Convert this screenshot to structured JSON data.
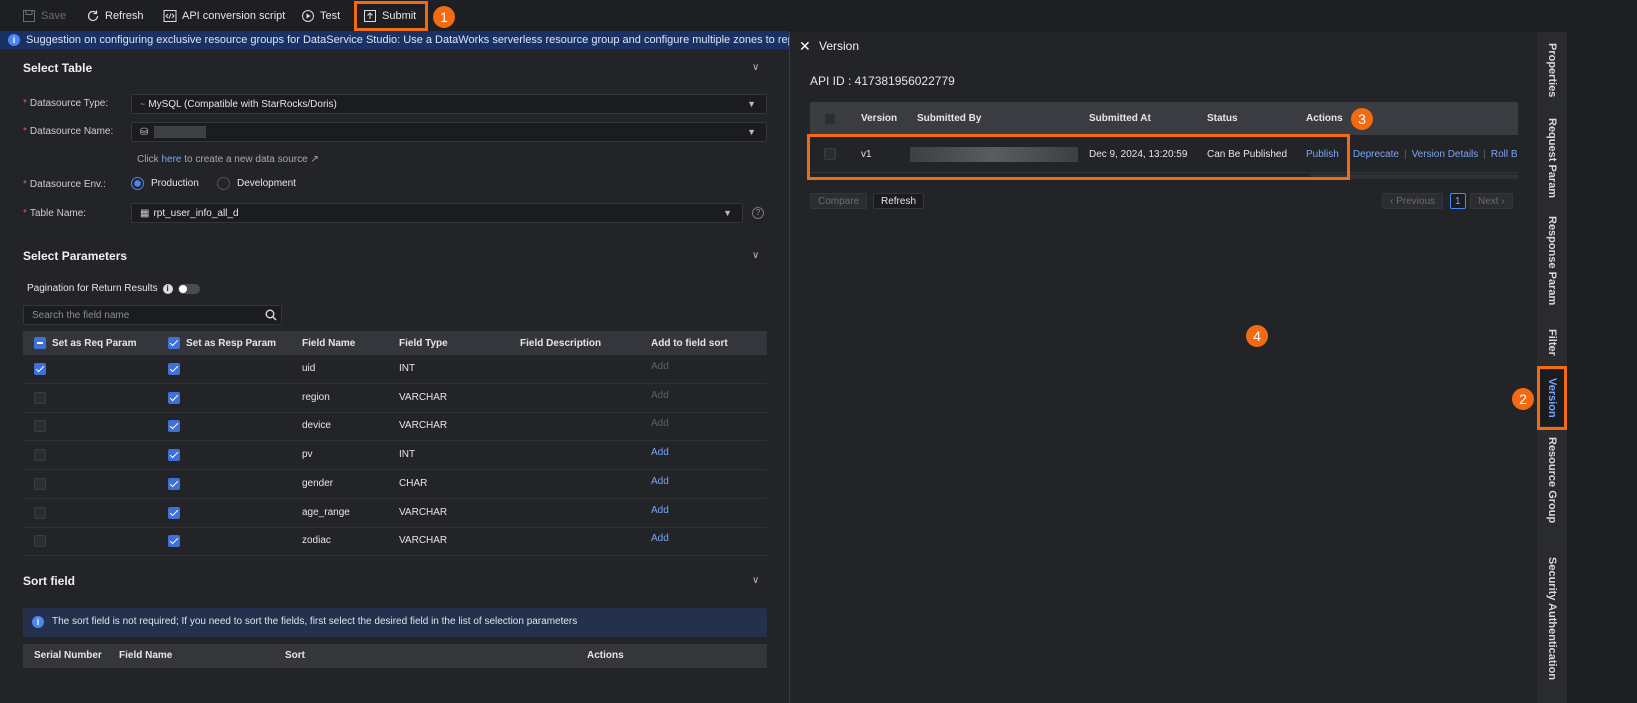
{
  "toolbar": {
    "save": "Save",
    "refresh": "Refresh",
    "api_conversion": "API conversion script",
    "test": "Test",
    "submit": "Submit"
  },
  "banner": {
    "text": "Suggestion on configuring exclusive resource groups for DataService Studio: Use a DataWorks serverless resource group and configure multiple zones to replace the old-version"
  },
  "select_table": {
    "title": "Select Table",
    "datasource_type_label": "Datasource Type:",
    "datasource_type_value": "MySQL (Compatible with StarRocks/Doris)",
    "datasource_name_label": "Datasource Name:",
    "create_link_prefix": "Click",
    "create_link_here": "here",
    "create_link_suffix": "to create a new data source",
    "datasource_env_label": "Datasource Env.:",
    "env_production": "Production",
    "env_development": "Development",
    "table_name_label": "Table Name:",
    "table_name_value": "rpt_user_info_all_d"
  },
  "select_parameters": {
    "title": "Select Parameters",
    "pagination_label": "Pagination for Return Results",
    "search_placeholder": "Search the field name",
    "columns": {
      "req": "Set as Req Param",
      "resp": "Set as Resp Param",
      "field_name": "Field Name",
      "field_type": "Field Type",
      "field_desc": "Field Description",
      "add_sort": "Add to field sort"
    },
    "rows": [
      {
        "req": true,
        "resp": true,
        "name": "uid",
        "type": "INT",
        "add": "Add",
        "add_enabled": false
      },
      {
        "req": false,
        "resp": true,
        "name": "region",
        "type": "VARCHAR",
        "add": "Add",
        "add_enabled": false
      },
      {
        "req": false,
        "resp": true,
        "name": "device",
        "type": "VARCHAR",
        "add": "Add",
        "add_enabled": false
      },
      {
        "req": false,
        "resp": true,
        "name": "pv",
        "type": "INT",
        "add": "Add",
        "add_enabled": true
      },
      {
        "req": false,
        "resp": true,
        "name": "gender",
        "type": "CHAR",
        "add": "Add",
        "add_enabled": true
      },
      {
        "req": false,
        "resp": true,
        "name": "age_range",
        "type": "VARCHAR",
        "add": "Add",
        "add_enabled": true
      },
      {
        "req": false,
        "resp": true,
        "name": "zodiac",
        "type": "VARCHAR",
        "add": "Add",
        "add_enabled": true
      }
    ]
  },
  "sort_field": {
    "title": "Sort field",
    "notice": "The sort field is not required; If you need to sort the fields, first select the desired field in the list of selection parameters",
    "columns": {
      "serial": "Serial Number",
      "field_name": "Field Name",
      "sort": "Sort",
      "actions": "Actions"
    }
  },
  "version_panel": {
    "title": "Version",
    "api_id": "API ID : 417381956022779",
    "columns": {
      "version": "Version",
      "submitted_by": "Submitted By",
      "submitted_at": "Submitted At",
      "status": "Status",
      "actions": "Actions"
    },
    "row": {
      "version": "v1",
      "submitted_at": "Dec 9, 2024, 13:20:59",
      "status": "Can Be Published",
      "publish": "Publish",
      "deprecate": "Deprecate",
      "version_details": "Version Details",
      "roll_back": "Roll B"
    },
    "compare": "Compare",
    "refresh": "Refresh",
    "previous": "Previous",
    "page": "1",
    "next": "Next"
  },
  "side_tabs": [
    "Properties",
    "Request Param",
    "Response Param",
    "Filter",
    "Version",
    "Resource Group",
    "Security Authentication"
  ],
  "callouts": [
    "1",
    "2",
    "3",
    "4"
  ],
  "colors": {
    "accent": "#f26b12",
    "link": "#7aa5f7",
    "primary": "#3f6fd8"
  }
}
